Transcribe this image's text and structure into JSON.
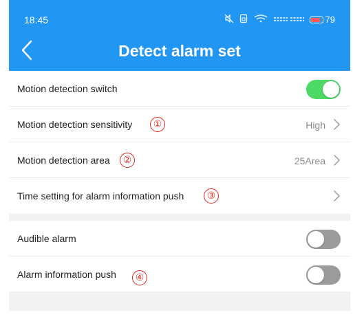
{
  "status_bar": {
    "time": "18:45",
    "icons": [
      "mute-icon",
      "sim-icon",
      "wifi-icon",
      "signal-icon"
    ],
    "battery_level": "79"
  },
  "header": {
    "title": "Detect alarm set",
    "back_icon": "chevron-left-icon"
  },
  "settings": {
    "motion_switch": {
      "label": "Motion detection switch",
      "state": "on"
    },
    "sensitivity": {
      "label": "Motion detection sensitivity",
      "value": "High",
      "marker": "①"
    },
    "area": {
      "label": "Motion detection area",
      "value": "25Area",
      "marker": "②"
    },
    "push_time": {
      "label": "Time setting for alarm information push",
      "marker": "③"
    },
    "audible_alarm": {
      "label": "Audible alarm",
      "state": "off"
    },
    "alarm_push": {
      "label": "Alarm information push",
      "state": "off",
      "marker": "④"
    }
  },
  "colors": {
    "header": "#2196f3",
    "switch_on": "#4cd964",
    "switch_off": "#9b9b9b",
    "marker": "#e0281e"
  }
}
